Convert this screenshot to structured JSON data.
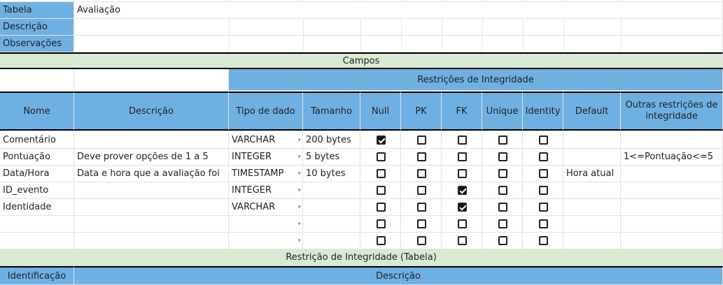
{
  "meta": {
    "tabela_label": "Tabela",
    "tabela_value": "Avaliação",
    "descricao_label": "Descrição",
    "observacoes_label": "Observações"
  },
  "campos_title": "Campos",
  "restricoes_title": "Restrições de Integridade",
  "headers": {
    "nome": "Nome",
    "descricao": "Descrição",
    "tipo": "Tipo de dado",
    "tamanho": "Tamanho",
    "null": "Null",
    "pk": "PK",
    "fk": "FK",
    "unique": "Unique",
    "identity": "Identity",
    "default": "Default",
    "outras": "Outras restrições de integridade"
  },
  "rows": [
    {
      "nome": "Comentário",
      "descricao": "",
      "tipo": "VARCHAR",
      "tamanho": "200 bytes",
      "null": true,
      "pk": false,
      "fk": false,
      "unique": false,
      "identity": false,
      "default": "",
      "outras": ""
    },
    {
      "nome": "Pontuação",
      "descricao": "Deve prover opções de 1 a 5",
      "tipo": "INTEGER",
      "tamanho": "5 bytes",
      "null": false,
      "pk": false,
      "fk": false,
      "unique": false,
      "identity": false,
      "default": "",
      "outras": "1<=Pontuação<=5"
    },
    {
      "nome": "Data/Hora",
      "descricao": "Data e hora que a avaliação foi",
      "tipo": "TIMESTAMP",
      "tamanho": "10 bytes",
      "null": false,
      "pk": false,
      "fk": false,
      "unique": false,
      "identity": false,
      "default": "Hora atual",
      "outras": ""
    },
    {
      "nome": "ID_evento",
      "descricao": "",
      "tipo": "INTEGER",
      "tamanho": "",
      "null": false,
      "pk": false,
      "fk": true,
      "unique": false,
      "identity": false,
      "default": "",
      "outras": ""
    },
    {
      "nome": "Identidade",
      "descricao": "",
      "tipo": "VARCHAR",
      "tamanho": "",
      "null": false,
      "pk": false,
      "fk": true,
      "unique": false,
      "identity": false,
      "default": "",
      "outras": ""
    },
    {
      "nome": "",
      "descricao": "",
      "tipo": "",
      "tamanho": "",
      "null": false,
      "pk": false,
      "fk": false,
      "unique": false,
      "identity": false,
      "default": "",
      "outras": ""
    },
    {
      "nome": "",
      "descricao": "",
      "tipo": "",
      "tamanho": "",
      "null": false,
      "pk": false,
      "fk": false,
      "unique": false,
      "identity": false,
      "default": "",
      "outras": ""
    }
  ],
  "tabela_restricao_title": "Restrição de Integridade (Tabela)",
  "footer_headers": {
    "identificacao": "Identificação",
    "descricao": "Descrição"
  },
  "colors": {
    "header_blue": "#6fb0e3",
    "section_green": "#d9ead3"
  }
}
